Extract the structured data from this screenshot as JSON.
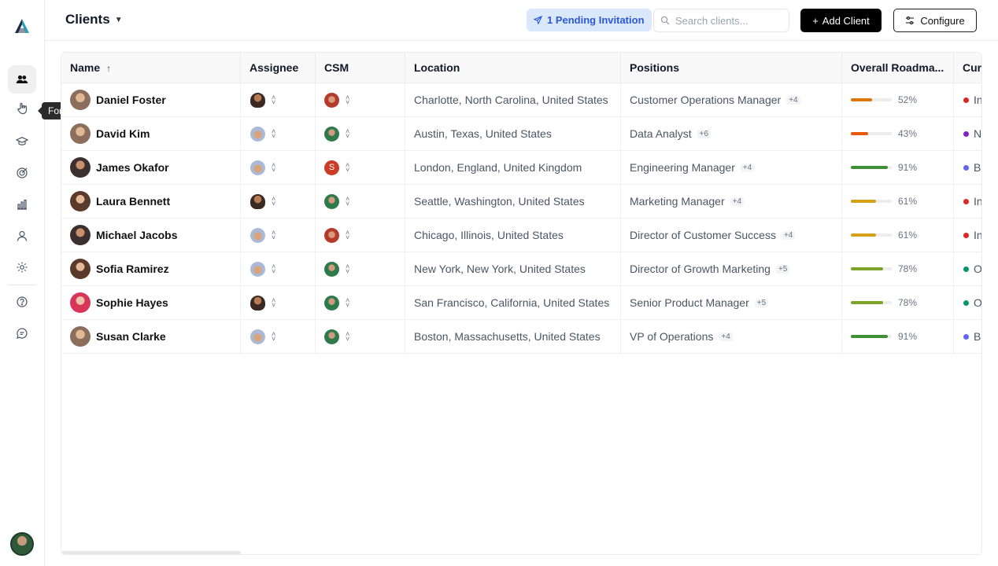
{
  "sidebar": {
    "tooltip": "Forms",
    "items": [
      {
        "icon": "users-icon",
        "active": true
      },
      {
        "icon": "hand-pointer-icon",
        "active": false
      },
      {
        "icon": "graduation-cap-icon",
        "active": false
      },
      {
        "icon": "target-icon",
        "active": false
      },
      {
        "icon": "bar-chart-icon",
        "active": false
      },
      {
        "icon": "user-icon",
        "active": false
      },
      {
        "icon": "gear-icon",
        "active": false
      },
      {
        "icon": "help-icon",
        "active": false
      },
      {
        "icon": "chat-icon",
        "active": false
      }
    ]
  },
  "header": {
    "title": "Clients",
    "pending": "1 Pending Invitation",
    "search_placeholder": "Search clients...",
    "add_label": "Add Client",
    "configure_label": "Configure"
  },
  "table": {
    "columns": [
      "Name",
      "Assignee",
      "CSM",
      "Location",
      "Positions",
      "Overall Roadma...",
      "Curr"
    ],
    "rows": [
      {
        "name": "Daniel Foster",
        "avatar": "av-light",
        "assignee": "mini-man",
        "csm": "mini-red",
        "csm_letter": "",
        "location": "Charlotte, North Carolina, United States",
        "position": "Customer Operations Manager",
        "more": "+4",
        "progress": 52,
        "progress_label": "52%",
        "bar_color": "#d97706",
        "status": "In",
        "status_color": "#dc2626"
      },
      {
        "name": "David Kim",
        "avatar": "av-light",
        "assignee": "mini-group",
        "csm": "mini-green",
        "csm_letter": "",
        "location": "Austin, Texas, United States",
        "position": "Data Analyst",
        "more": "+6",
        "progress": 43,
        "progress_label": "43%",
        "bar_color": "#ea580c",
        "status": "No",
        "status_color": "#7e22ce"
      },
      {
        "name": "James Okafor",
        "avatar": "av-dark",
        "assignee": "mini-group",
        "csm": "mini-s",
        "csm_letter": "S",
        "location": "London, England, United Kingdom",
        "position": "Engineering Manager",
        "more": "+4",
        "progress": 91,
        "progress_label": "91%",
        "bar_color": "#3f8f35",
        "status": "Be",
        "status_color": "#6366f1"
      },
      {
        "name": "Laura Bennett",
        "avatar": "av-female",
        "assignee": "mini-man",
        "csm": "mini-green",
        "csm_letter": "",
        "location": "Seattle, Washington, United States",
        "position": "Marketing Manager",
        "more": "+4",
        "progress": 61,
        "progress_label": "61%",
        "bar_color": "#d4a017",
        "status": "In",
        "status_color": "#dc2626"
      },
      {
        "name": "Michael Jacobs",
        "avatar": "av-dark",
        "assignee": "mini-group",
        "csm": "mini-red",
        "csm_letter": "",
        "location": "Chicago, Illinois, United States",
        "position": "Director of Customer Success",
        "more": "+4",
        "progress": 61,
        "progress_label": "61%",
        "bar_color": "#d4a017",
        "status": "In",
        "status_color": "#dc2626"
      },
      {
        "name": "Sofia Ramirez",
        "avatar": "av-female",
        "assignee": "mini-group",
        "csm": "mini-green",
        "csm_letter": "",
        "location": "New York, New York, United States",
        "position": "Director of Growth Marketing",
        "more": "+5",
        "progress": 78,
        "progress_label": "78%",
        "bar_color": "#7ca22a",
        "status": "Of",
        "status_color": "#059669"
      },
      {
        "name": "Sophie Hayes",
        "avatar": "av-pink",
        "assignee": "mini-man",
        "csm": "mini-green",
        "csm_letter": "",
        "location": "San Francisco, California, United States",
        "position": "Senior Product Manager",
        "more": "+5",
        "progress": 78,
        "progress_label": "78%",
        "bar_color": "#7ca22a",
        "status": "Of",
        "status_color": "#059669"
      },
      {
        "name": "Susan Clarke",
        "avatar": "av-light",
        "assignee": "mini-group",
        "csm": "mini-green",
        "csm_letter": "",
        "location": "Boston, Massachusetts, United States",
        "position": "VP of Operations",
        "more": "+4",
        "progress": 91,
        "progress_label": "91%",
        "bar_color": "#3f8f35",
        "status": "Be",
        "status_color": "#6366f1"
      }
    ]
  }
}
